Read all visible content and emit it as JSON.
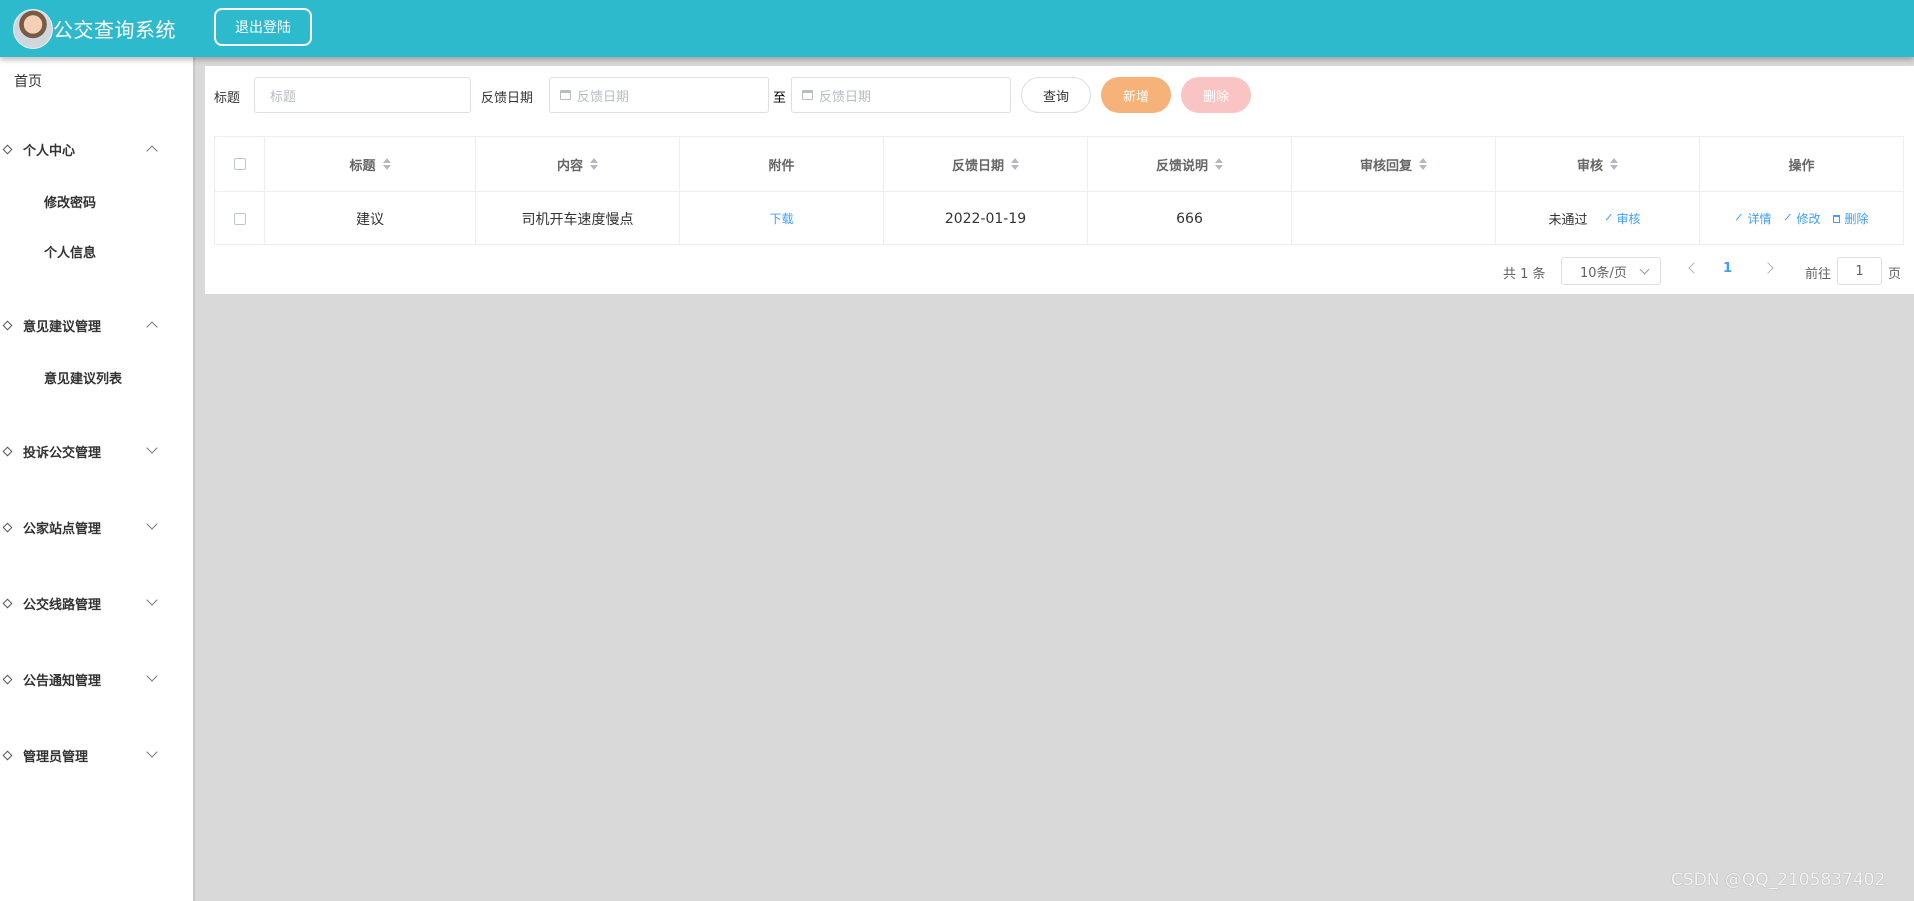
{
  "header": {
    "title": "公交查询系统",
    "logout_label": "退出登陆"
  },
  "sidebar": {
    "home": "首页",
    "groups": [
      {
        "label": "个人中心",
        "expanded": true,
        "items": [
          "修改密码",
          "个人信息"
        ]
      },
      {
        "label": "意见建议管理",
        "expanded": true,
        "items": [
          "意见建议列表"
        ]
      },
      {
        "label": "投诉公交管理",
        "expanded": false
      },
      {
        "label": "公家站点管理",
        "expanded": false
      },
      {
        "label": "公交线路管理",
        "expanded": false
      },
      {
        "label": "公告通知管理",
        "expanded": false
      },
      {
        "label": "管理员管理",
        "expanded": false
      }
    ]
  },
  "filters": {
    "title_label": "标题",
    "title_placeholder": "标题",
    "date_label": "反馈日期",
    "date_start_placeholder": "反馈日期",
    "date_separator": "至",
    "date_end_placeholder": "反馈日期",
    "query_label": "查询",
    "add_label": "新增",
    "delete_label": "删除"
  },
  "table": {
    "columns": [
      "标题",
      "内容",
      "附件",
      "反馈日期",
      "反馈说明",
      "审核回复",
      "审核",
      "操作"
    ],
    "rows": [
      {
        "title": "建议",
        "content": "司机开车速度慢点",
        "attachment": "下载",
        "date": "2022-01-19",
        "feedback": "666",
        "reply": "",
        "status": "未通过",
        "review_action": "审核",
        "actions": [
          "详情",
          "修改",
          "删除"
        ]
      }
    ]
  },
  "pagination": {
    "total": "共 1 条",
    "page_size": "10条/页",
    "current_page": "1",
    "goto_label": "前往",
    "goto_value": "1",
    "page_suffix": "页"
  },
  "watermark": "CSDN @QQ_2105837402",
  "colors": {
    "header": "#2dbacd",
    "add_button": "#f7b27a",
    "delete_button": "#fbc4c4",
    "link": "#409eff"
  }
}
